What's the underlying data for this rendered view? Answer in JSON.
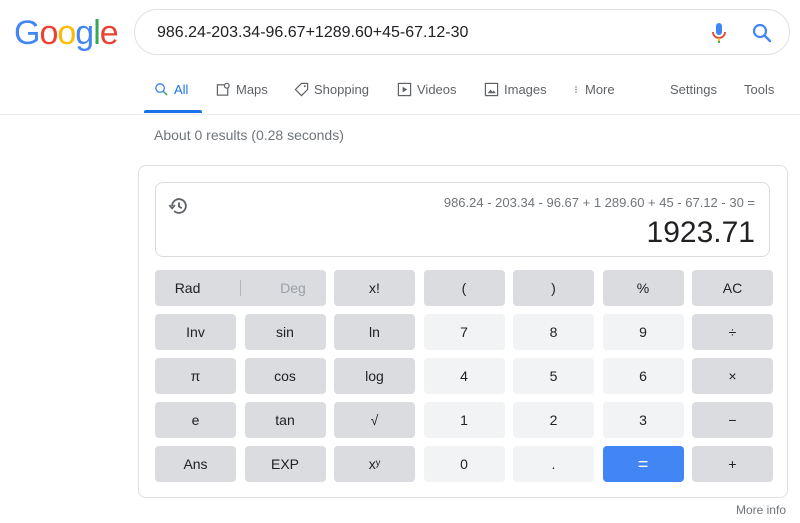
{
  "logo": {
    "letters": [
      "G",
      "o",
      "o",
      "g",
      "l",
      "e"
    ],
    "colors": [
      "#4285f4",
      "#ea4335",
      "#fbbc05",
      "#4285f4",
      "#34a853",
      "#ea4335"
    ]
  },
  "search": {
    "value": "986.24-203.34-96.67+1289.60+45-67.12-30",
    "icons": [
      "mic-icon",
      "search-icon"
    ]
  },
  "tabs": [
    {
      "label": "All",
      "icon": "search-icon",
      "active": true
    },
    {
      "label": "Maps",
      "icon": "map-icon"
    },
    {
      "label": "Shopping",
      "icon": "tag-icon"
    },
    {
      "label": "Videos",
      "icon": "play-icon"
    },
    {
      "label": "Images",
      "icon": "image-icon"
    },
    {
      "label": "More",
      "icon": "more-vert-icon"
    },
    {
      "label": "Settings"
    },
    {
      "label": "Tools"
    }
  ],
  "stats": "About 0 results (0.28 seconds)",
  "calculator": {
    "expression": "986.24 - 203.34 - 96.67 + 1 289.60 + 45 - 67.12 - 30 =",
    "result": "1923.71",
    "mode": {
      "rad": "Rad",
      "deg": "Deg",
      "active": "Rad"
    },
    "keys": [
      "x!",
      "(",
      ")",
      "%",
      "AC",
      "Inv",
      "sin",
      "ln",
      "7",
      "8",
      "9",
      "÷",
      "π",
      "cos",
      "log",
      "4",
      "5",
      "6",
      "×",
      "e",
      "tan",
      "√",
      "1",
      "2",
      "3",
      "−",
      "Ans",
      "EXP",
      "xʸ",
      "0",
      ".",
      "=",
      "+"
    ],
    "accent_color": "#4285f4"
  },
  "more_info": "More info"
}
